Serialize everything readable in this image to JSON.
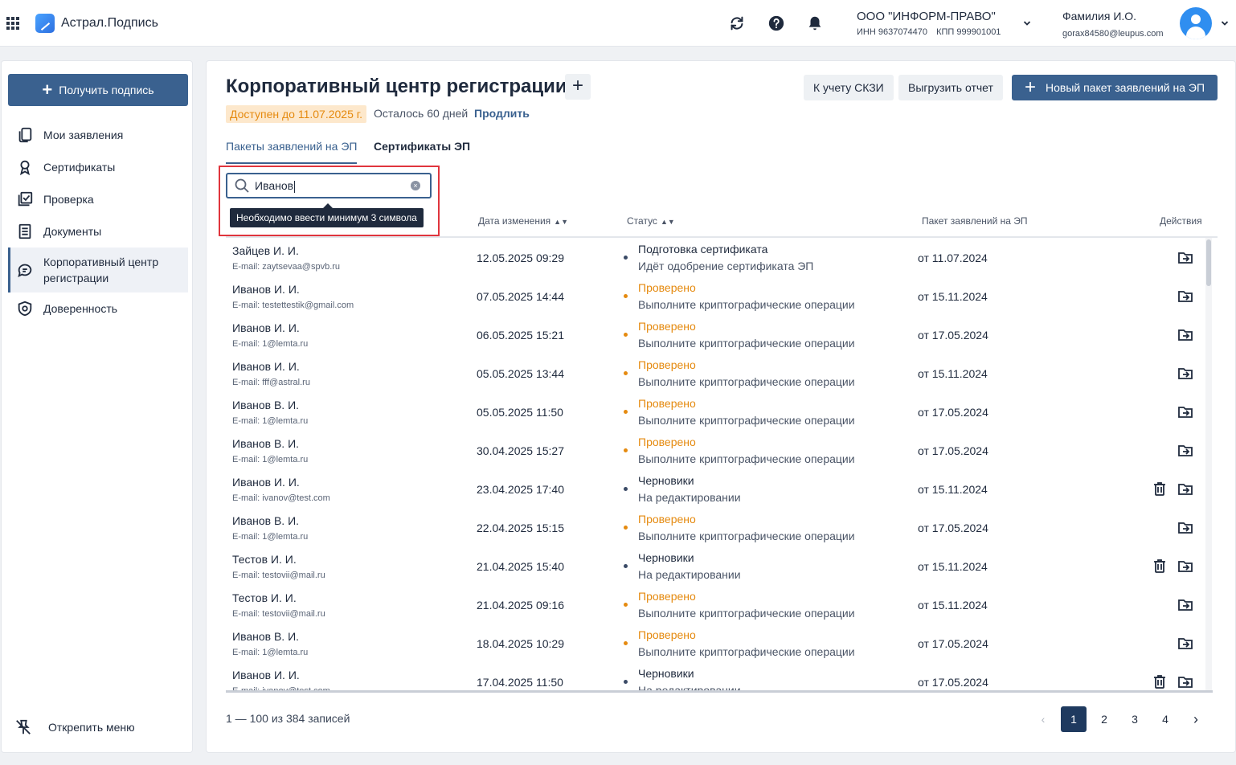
{
  "app": {
    "title": "Астрал.Подпись"
  },
  "org": {
    "name": "ООО \"ИНФОРМ-ПРАВО\"",
    "inn": "ИНН 9637074470",
    "kpp": "КПП 999901001"
  },
  "user": {
    "name": "Фамилия И.О.",
    "email": "gorax84580@leupus.com"
  },
  "sidebar": {
    "get_sign_label": "Получить подпись",
    "items": [
      {
        "label": "Мои заявления",
        "icon": "copy-icon"
      },
      {
        "label": "Сертификаты",
        "icon": "award-icon"
      },
      {
        "label": "Проверка",
        "icon": "check-square-icon"
      },
      {
        "label": "Документы",
        "icon": "document-icon"
      },
      {
        "label": "Корпоративный центр регистрации",
        "icon": "chat-icon",
        "active": true
      },
      {
        "label": "Доверенность",
        "icon": "shield-icon"
      }
    ],
    "unpin_label": "Открепить меню"
  },
  "page": {
    "title": "Корпоративный центр регистрации",
    "available": "Доступен до 11.07.2025 г.",
    "remaining": "Осталось 60 дней",
    "prolong": "Продлить",
    "btn_skzi": "К учету СКЗИ",
    "btn_report": "Выгрузить отчет",
    "btn_new": "Новый пакет заявлений на ЭП"
  },
  "tabs": [
    {
      "label": "Пакеты заявлений на ЭП",
      "active": true
    },
    {
      "label": "Сертификаты ЭП",
      "active": false
    }
  ],
  "search": {
    "value": "Иванов",
    "tooltip": "Необходимо ввести минимум 3 символа"
  },
  "table": {
    "headers": {
      "date": "Дата изменения",
      "status": "Статус",
      "pack": "Пакет заявлений на ЭП",
      "actions": "Действия"
    },
    "rows": [
      {
        "name": "Зайцев И. И.",
        "email": "E-mail: zaytsevaa@spvb.ru",
        "date": "12.05.2025 09:29",
        "status": "Подготовка сертификата",
        "status_kind": "dark",
        "sub": "Идёт одобрение сертификата ЭП",
        "pack": "от 11.07.2024",
        "trash": false
      },
      {
        "name": "Иванов И. И.",
        "email": "E-mail: testettestik@gmail.com",
        "date": "07.05.2025 14:44",
        "status": "Проверено",
        "status_kind": "orange",
        "sub": "Выполните криптографические операции",
        "pack": "от 15.11.2024",
        "trash": false
      },
      {
        "name": "Иванов И. И.",
        "email": "E-mail: 1@lemta.ru",
        "date": "06.05.2025 15:21",
        "status": "Проверено",
        "status_kind": "orange",
        "sub": "Выполните криптографические операции",
        "pack": "от 17.05.2024",
        "trash": false
      },
      {
        "name": "Иванов И. И.",
        "email": "E-mail: fff@astral.ru",
        "date": "05.05.2025 13:44",
        "status": "Проверено",
        "status_kind": "orange",
        "sub": "Выполните криптографические операции",
        "pack": "от 15.11.2024",
        "trash": false
      },
      {
        "name": "Иванов В. И.",
        "email": "E-mail: 1@lemta.ru",
        "date": "05.05.2025 11:50",
        "status": "Проверено",
        "status_kind": "orange",
        "sub": "Выполните криптографические операции",
        "pack": "от 17.05.2024",
        "trash": false
      },
      {
        "name": "Иванов В. И.",
        "email": "E-mail: 1@lemta.ru",
        "date": "30.04.2025 15:27",
        "status": "Проверено",
        "status_kind": "orange",
        "sub": "Выполните криптографические операции",
        "pack": "от 17.05.2024",
        "trash": false
      },
      {
        "name": "Иванов И. И.",
        "email": "E-mail: ivanov@test.com",
        "date": "23.04.2025 17:40",
        "status": "Черновики",
        "status_kind": "dark",
        "sub": "На редактировании",
        "pack": "от 15.11.2024",
        "trash": true
      },
      {
        "name": "Иванов В. И.",
        "email": "E-mail: 1@lemta.ru",
        "date": "22.04.2025 15:15",
        "status": "Проверено",
        "status_kind": "orange",
        "sub": "Выполните криптографические операции",
        "pack": "от 17.05.2024",
        "trash": false
      },
      {
        "name": "Тестов И. И.",
        "email": "E-mail: testovii@mail.ru",
        "date": "21.04.2025 15:40",
        "status": "Черновики",
        "status_kind": "dark",
        "sub": "На редактировании",
        "pack": "от 15.11.2024",
        "trash": true
      },
      {
        "name": "Тестов И. И.",
        "email": "E-mail: testovii@mail.ru",
        "date": "21.04.2025 09:16",
        "status": "Проверено",
        "status_kind": "orange",
        "sub": "Выполните криптографические операции",
        "pack": "от 15.11.2024",
        "trash": false
      },
      {
        "name": "Иванов В. И.",
        "email": "E-mail: 1@lemta.ru",
        "date": "18.04.2025 10:29",
        "status": "Проверено",
        "status_kind": "orange",
        "sub": "Выполните криптографические операции",
        "pack": "от 17.05.2024",
        "trash": false
      },
      {
        "name": "Иванов И. И.",
        "email": "E-mail: ivanov@test.com",
        "date": "17.04.2025 11:50",
        "status": "Черновики",
        "status_kind": "dark",
        "sub": "На редактировании",
        "pack": "от 17.05.2024",
        "trash": true
      }
    ]
  },
  "pagination": {
    "summary": "1 — 100 из 384 записей",
    "pages": [
      "1",
      "2",
      "3",
      "4"
    ],
    "current": "1"
  },
  "colors": {
    "primary": "#3a618f",
    "orange": "#e58a0f",
    "dark": "#1f2a3d",
    "highlight": "#e0353d"
  }
}
